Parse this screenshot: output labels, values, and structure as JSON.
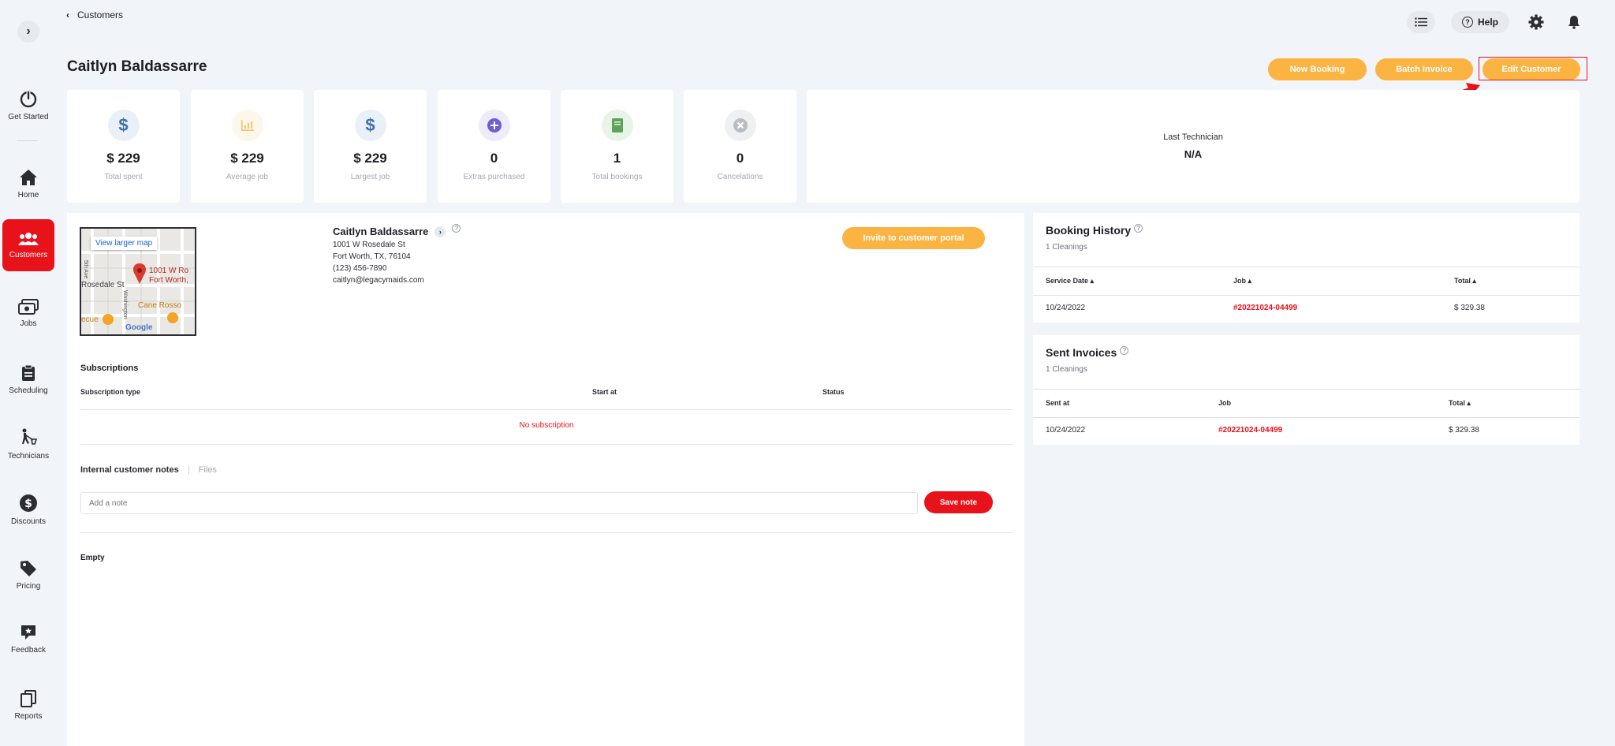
{
  "breadcrumb": {
    "back_label": "Customers"
  },
  "topbar": {
    "help_label": "Help"
  },
  "sidebar": {
    "items": [
      {
        "label": "Get Started",
        "icon": "power-icon"
      },
      {
        "label": "Home",
        "icon": "home-icon"
      },
      {
        "label": "Customers",
        "icon": "customers-icon"
      },
      {
        "label": "Jobs",
        "icon": "jobs-icon"
      },
      {
        "label": "Scheduling",
        "icon": "clipboard-icon"
      },
      {
        "label": "Technicians",
        "icon": "technician-icon"
      },
      {
        "label": "Discounts",
        "icon": "discount-icon"
      },
      {
        "label": "Pricing",
        "icon": "tag-icon"
      },
      {
        "label": "Feedback",
        "icon": "feedback-icon"
      },
      {
        "label": "Reports",
        "icon": "reports-icon"
      }
    ]
  },
  "header": {
    "title": "Caitlyn Baldassarre",
    "new_booking": "New Booking",
    "batch_invoice": "Batch Invoice",
    "edit_customer": "Edit Customer"
  },
  "stats": [
    {
      "value": "$ 229",
      "label": "Total spent",
      "icon": "dollar-icon",
      "color": "#3f6fae",
      "bg": "#eaf0f7"
    },
    {
      "value": "$ 229",
      "label": "Average job",
      "icon": "bar-chart-icon",
      "color": "#f3c36f",
      "bg": "#fdf6ea"
    },
    {
      "value": "$ 229",
      "label": "Largest job",
      "icon": "dollar-icon",
      "color": "#3f6fae",
      "bg": "#eaf0f7"
    },
    {
      "value": "0",
      "label": "Extras purchased",
      "icon": "plus-circle-icon",
      "color": "#6b5fd6",
      "bg": "#eeecfa"
    },
    {
      "value": "1",
      "label": "Total bookings",
      "icon": "book-icon",
      "color": "#5fa35a",
      "bg": "#e9f4e8"
    },
    {
      "value": "0",
      "label": "Cancelations",
      "icon": "cancel-icon",
      "color": "#b9bcc3",
      "bg": "#eff0f2"
    }
  ],
  "last_technician": {
    "label": "Last Technician",
    "value": "N/A"
  },
  "customer": {
    "name": "Caitlyn Baldassarre",
    "address1": "1001 W Rosedale St",
    "address2": "Fort Worth, TX, 76104",
    "phone": "(123) 456-7890",
    "email": "caitlyn@legacymaids.com",
    "invite_label": "Invite to customer portal"
  },
  "map": {
    "view_larger": "View larger map",
    "pin_label_1": "1001 W Ro",
    "pin_label_2": "Fort Worth,",
    "street": "Rosedale St",
    "avenue": "5th Ave",
    "street2": "Washington",
    "place": "Cane Rosso",
    "place2": "ecue",
    "logo": "Google"
  },
  "subscriptions": {
    "title": "Subscriptions",
    "headers": [
      "Subscription type",
      "Start at",
      "Status"
    ],
    "empty_text": "No subscription"
  },
  "notes": {
    "tab_notes": "Internal customer notes",
    "tab_files": "Files",
    "placeholder": "Add a note",
    "save_label": "Save note",
    "empty_text": "Empty"
  },
  "booking_history": {
    "title": "Booking History",
    "subtitle": "1 Cleanings",
    "headers": [
      "Service Date ▴",
      "Job ▴",
      "Total ▴"
    ],
    "rows": [
      {
        "date": "10/24/2022",
        "job": "#20221024-04499",
        "total": "$ 329.38"
      }
    ]
  },
  "sent_invoices": {
    "title": "Sent Invoices",
    "subtitle": "1 Cleanings",
    "headers": [
      "Sent at",
      "Job",
      "Total ▴"
    ],
    "rows": [
      {
        "date": "10/24/2022",
        "job": "#20221024-04499",
        "total": "$ 329.38"
      }
    ]
  }
}
